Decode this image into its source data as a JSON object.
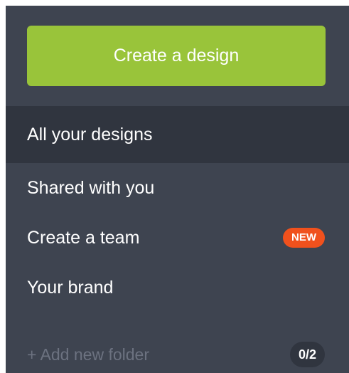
{
  "create_button": {
    "label": "Create a design"
  },
  "nav": {
    "items": [
      {
        "label": "All your designs",
        "active": true
      },
      {
        "label": "Shared with you"
      },
      {
        "label": "Create a team",
        "badge": "NEW"
      },
      {
        "label": "Your brand"
      }
    ]
  },
  "folders": {
    "add_label": "+ Add new folder",
    "count": "0/2"
  },
  "colors": {
    "sidebar_bg": "#3e4450",
    "active_bg": "#30353f",
    "primary": "#99c43a",
    "badge": "#f0511d"
  }
}
